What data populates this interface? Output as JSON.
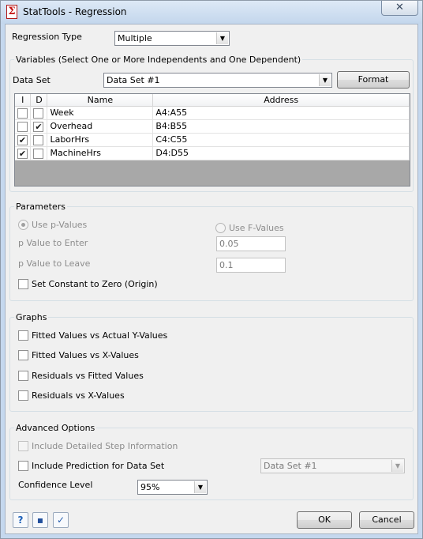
{
  "window": {
    "title": "StatTools - Regression",
    "close_glyph": "✕",
    "app_icon_glyph": "Σ"
  },
  "regression_type": {
    "label": "Regression Type",
    "value": "Multiple"
  },
  "variables": {
    "group_title": "Variables (Select One or More Independents and One Dependent)",
    "data_set_label": "Data Set",
    "data_set_value": "Data Set #1",
    "format_button": "Format",
    "columns": [
      "I",
      "D",
      "Name",
      "Address"
    ],
    "rows": [
      {
        "i": false,
        "d": false,
        "name": "Week",
        "address": "A4:A55"
      },
      {
        "i": false,
        "d": true,
        "name": "Overhead",
        "address": "B4:B55"
      },
      {
        "i": true,
        "d": false,
        "name": "LaborHrs",
        "address": "C4:C55"
      },
      {
        "i": true,
        "d": false,
        "name": "MachineHrs",
        "address": "D4:D55"
      }
    ]
  },
  "parameters": {
    "group_title": "Parameters",
    "use_p_values": "Use p-Values",
    "use_f_values": "Use F-Values",
    "p_enter_label": "p Value to Enter",
    "p_enter_value": "0.05",
    "p_leave_label": "p Value to Leave",
    "p_leave_value": "0.1",
    "constant_zero": "Set Constant to Zero (Origin)"
  },
  "graphs": {
    "group_title": "Graphs",
    "items": [
      "Fitted Values vs Actual Y-Values",
      "Fitted Values vs X-Values",
      "Residuals vs Fitted Values",
      "Residuals vs X-Values"
    ]
  },
  "advanced": {
    "group_title": "Advanced Options",
    "step_info": "Include Detailed Step Information",
    "prediction": "Include Prediction for Data Set",
    "prediction_data_set": "Data Set #1",
    "confidence_label": "Confidence Level",
    "confidence_value": "95%"
  },
  "footer": {
    "ok": "OK",
    "cancel": "Cancel",
    "help_glyph": "?",
    "save_glyph": "▪",
    "check_glyph": "✓"
  },
  "check_glyph": "✔",
  "arrow_glyph": "▼"
}
